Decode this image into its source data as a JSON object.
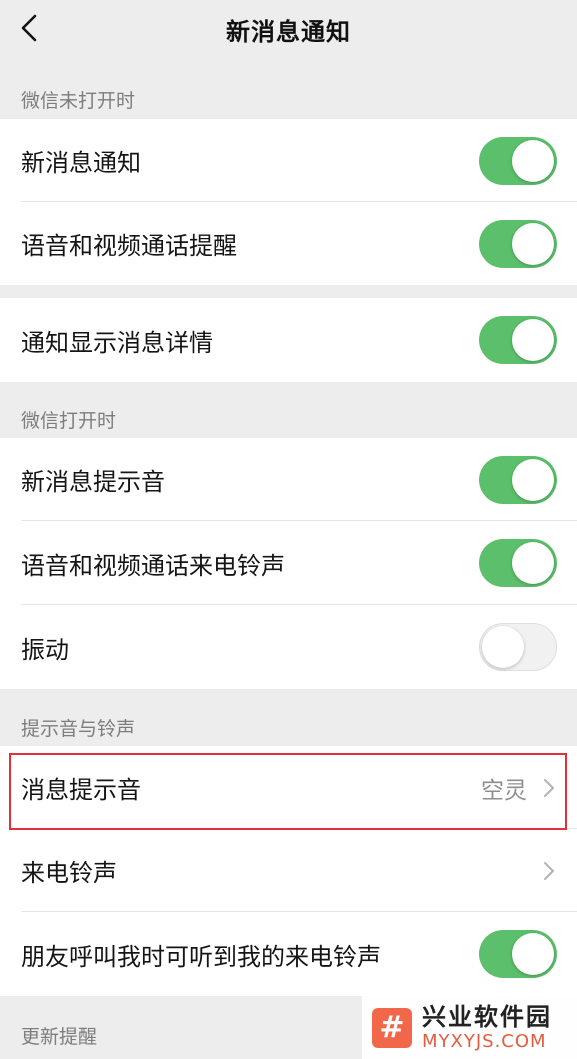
{
  "header": {
    "title": "新消息通知"
  },
  "sections": {
    "closed": "微信未打开时",
    "open": "微信打开时",
    "sounds": "提示音与铃声",
    "update": "更新提醒"
  },
  "rows": {
    "new_message": {
      "label": "新消息通知",
      "on": true
    },
    "call_reminder": {
      "label": "语音和视频通话提醒",
      "on": true
    },
    "show_details": {
      "label": "通知显示消息详情",
      "on": true
    },
    "message_sound": {
      "label": "新消息提示音",
      "on": true
    },
    "call_ringtone": {
      "label": "语音和视频通话来电铃声",
      "on": true
    },
    "vibrate": {
      "label": "振动",
      "on": false
    },
    "notification_sound": {
      "label": "消息提示音",
      "value": "空灵"
    },
    "incoming_ringtone": {
      "label": "来电铃声"
    },
    "friend_ringtone": {
      "label": "朋友呼叫我时可听到我的来电铃声",
      "on": true
    }
  },
  "watermark": {
    "logo": "#",
    "name": "兴业软件园",
    "site": "MYXYJS.COM"
  }
}
